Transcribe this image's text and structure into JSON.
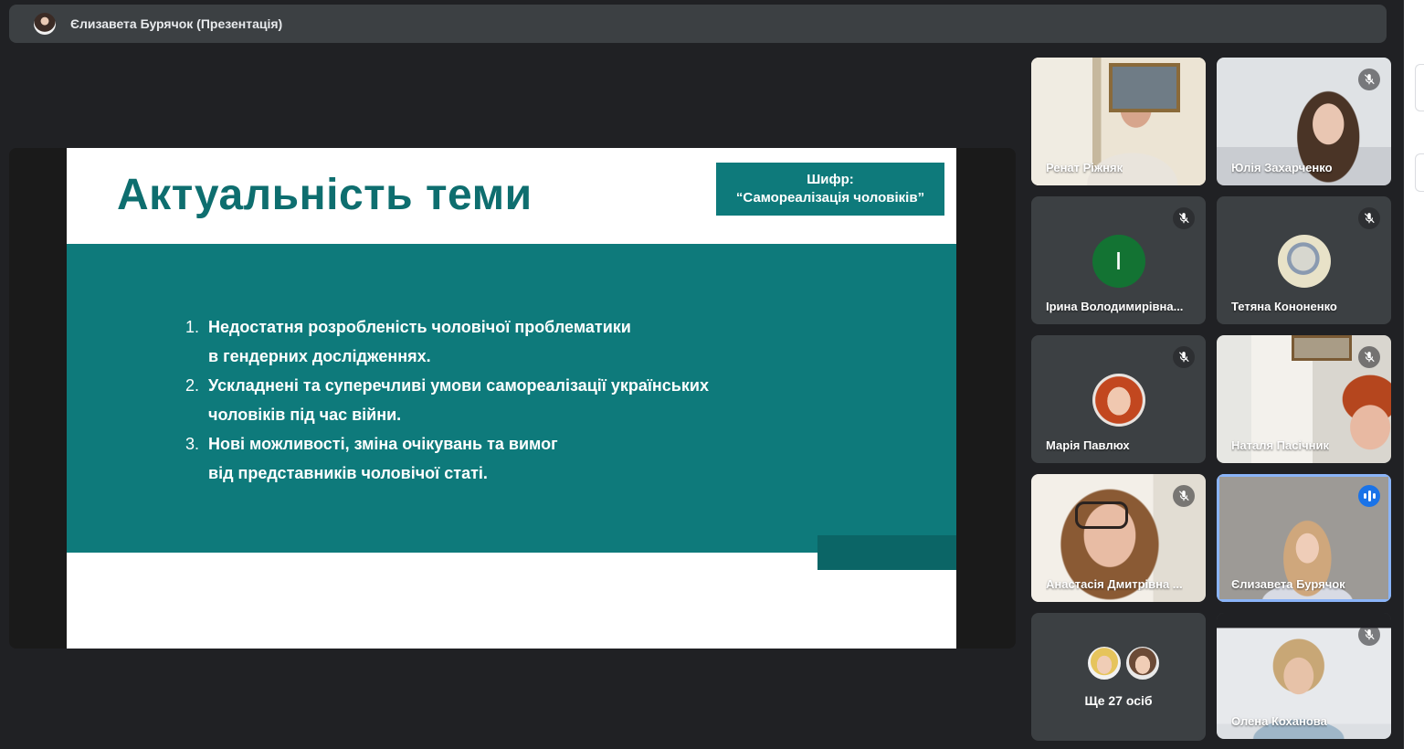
{
  "presenter_bar": {
    "title": "Єлизавета Бурячок (Презентація)"
  },
  "slide": {
    "title": "Актуальність теми",
    "cipher_label": "Шифр:",
    "cipher_value": "“Самореалізація чоловіків”",
    "points": [
      {
        "num": "1.",
        "text": "Недостатня розробленість чоловічої проблематики\nв  гендерних дослідженнях."
      },
      {
        "num": "2.",
        "text": "Ускладнені та суперечливі умови самореалізації українських\nчоловіків під час війни."
      },
      {
        "num": "3.",
        "text": "Нові можливості, зміна очікувань та вимог\nвід представників чоловічої статі."
      }
    ]
  },
  "participants": [
    {
      "name": "Ренат Ріжняк"
    },
    {
      "name": "Юлія Захарченко"
    },
    {
      "name": "Ірина Володимирівна...",
      "initial": "І"
    },
    {
      "name": "Тетяна Кононенко"
    },
    {
      "name": "Марія Павлюх"
    },
    {
      "name": "Наталя Пасічник"
    },
    {
      "name": "Анастасія Дмитрівна ..."
    },
    {
      "name": "Єлизавета Бурячок"
    },
    {
      "name": "Олена Коханова"
    }
  ],
  "more_participants": {
    "label": "Ще 27 осіб"
  },
  "colors": {
    "slide_teal": "#0e7a7b",
    "title_teal": "#0e6e6f",
    "background": "#202124",
    "tile": "#3c4043",
    "speaking_blue": "#1a73e8",
    "initial_avatar": "#137333"
  },
  "icons": {
    "muted": "mic-off-icon",
    "speaking": "audio-level-icon"
  }
}
